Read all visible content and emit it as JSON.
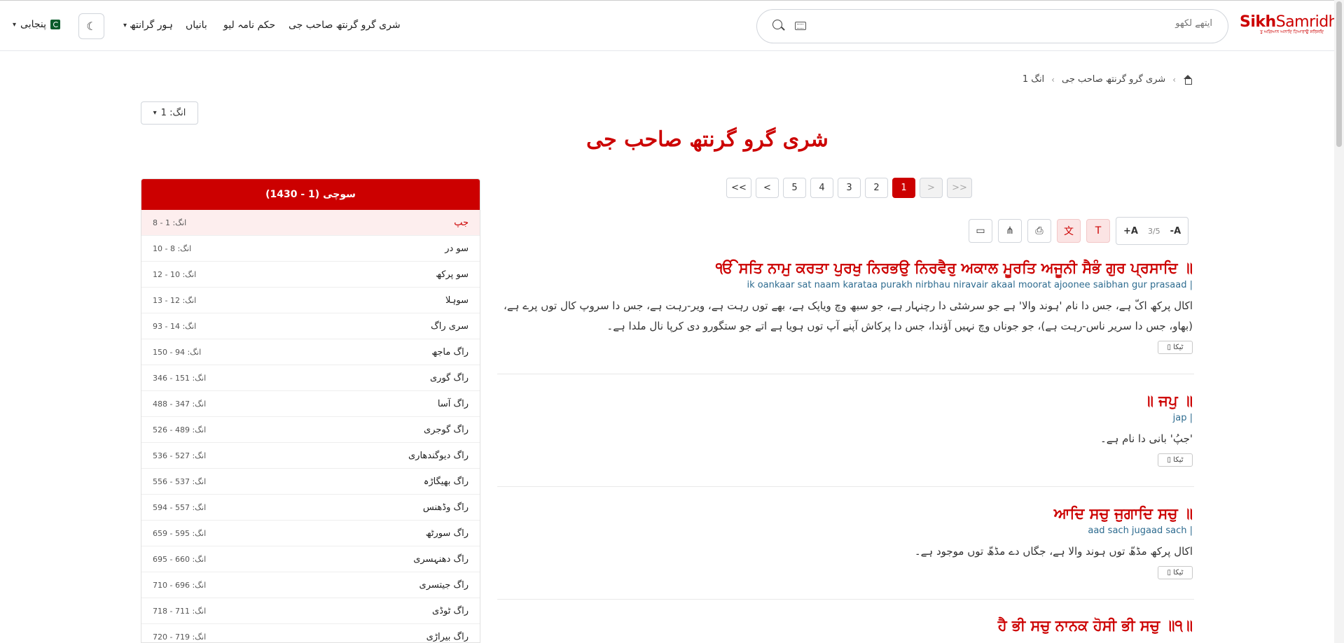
{
  "header": {
    "language": "پنجابی",
    "nav": [
      "شری گرو گرنتھ صاحب جی",
      "حکم نامہ لیو",
      "بانیاں",
      "ہور گرانتھ"
    ],
    "search_placeholder": "ایتھے لکھو",
    "logo_sikh": "Sikh",
    "logo_samridhi": "Samridhi",
    "logo_tagline": "ਤੁ ਅਗਿਆਨ ਅਨਾਦਿ ਹਿਆਰਾਉ ਸਰਿਸਦਿ"
  },
  "breadcrumb": [
    "شری گرو گرنتھ صاحب جی",
    "انگ 1"
  ],
  "ang_select": "انگ: 1",
  "page_title": "شری گرو گرنتھ صاحب جی",
  "toc": {
    "heading": "سوچی (1 - 1430)",
    "items": [
      {
        "name": "جپ",
        "range": "انگ: 1 - 8"
      },
      {
        "name": "سو در",
        "range": "انگ: 8 - 10"
      },
      {
        "name": "سو پرکھ",
        "range": "انگ: 10 - 12"
      },
      {
        "name": "سوہلا",
        "range": "انگ: 12 - 13"
      },
      {
        "name": "سری راگ",
        "range": "انگ: 14 - 93"
      },
      {
        "name": "راگ ماجھ",
        "range": "انگ: 94 - 150"
      },
      {
        "name": "راگ گوری",
        "range": "انگ: 151 - 346"
      },
      {
        "name": "راگ آسا",
        "range": "انگ: 347 - 488"
      },
      {
        "name": "راگ گوجری",
        "range": "انگ: 489 - 526"
      },
      {
        "name": "راگ دیوگندھاری",
        "range": "انگ: 527 - 536"
      },
      {
        "name": "راگ بھیگاڑہ",
        "range": "انگ: 537 - 556"
      },
      {
        "name": "راگ وڈھنس",
        "range": "انگ: 557 - 594"
      },
      {
        "name": "راگ سورٹھ",
        "range": "انگ: 595 - 659"
      },
      {
        "name": "راگ دھنہسری",
        "range": "انگ: 660 - 695"
      },
      {
        "name": "راگ جیتسری",
        "range": "انگ: 696 - 710"
      },
      {
        "name": "راگ ٹوڈی",
        "range": "انگ: 711 - 718"
      },
      {
        "name": "راگ بیراڑی",
        "range": "انگ: 719 - 720"
      }
    ]
  },
  "pager": [
    "<<",
    "<",
    "5",
    "4",
    "3",
    "2",
    "1",
    ">",
    ">>"
  ],
  "font_size": {
    "increase": "+A",
    "value": "3/5",
    "decrease": "-A"
  },
  "tika_label": "ٹیکا",
  "verses": [
    {
      "gurmukhi": "ੴ ਸਤਿ ਨਾਮੁ ਕਰਤਾ ਪੁਰਖੁ ਨਿਰਭਉ ਨਿਰਵੈਰੁ ਅਕਾਲ ਮੂਰਤਿ ਅਜੂਨੀ ਸੈਭੰ ਗੁਰ ਪ੍ਰਸਾਦਿ ॥",
      "translit": "ik oankaar sat naam karataa purakh nirbhau niravair akaal moorat ajoonee saibhan gur prasaad |",
      "meaning": "اکال پرکھ اکّ ہے، جس دا نام 'ہوند والا' ہے جو سرشٹی دا رچنہار ہے، جو سبھ وچ ویاپک ہے، بھے توں رہت ہے، ویر-رہت ہے، جس دا سروپ کال توں پرے ہے، (بھاو، جس دا سریر ناس-رہت ہے)، جو جوناں وچ نہیں آؤندا، جس دا پرکاش آپنے آپ توں ہویا ہے اتے جو ستگورو دی کرپا نال ملدا ہے۔"
    },
    {
      "gurmukhi": "॥ ਜਪੁ ॥",
      "translit": "jap |",
      "meaning": "'جپُ' بانی دا نام ہے۔"
    },
    {
      "gurmukhi": "ਆਦਿ ਸਚੁ ਜੁਗਾਦਿ ਸਚੁ ॥",
      "translit": "aad sach jugaad sach |",
      "meaning": "اکال پرکھ مڈھّ توں ہوند والا ہے، جگاں دے مڈھّ توں موجود ہے۔"
    },
    {
      "gurmukhi": "ਹੈ ਭੀ ਸਚੁ ਨਾਨਕ ਹੋਸੀ ਭੀ ਸਚੁ ॥੧॥"
    }
  ]
}
